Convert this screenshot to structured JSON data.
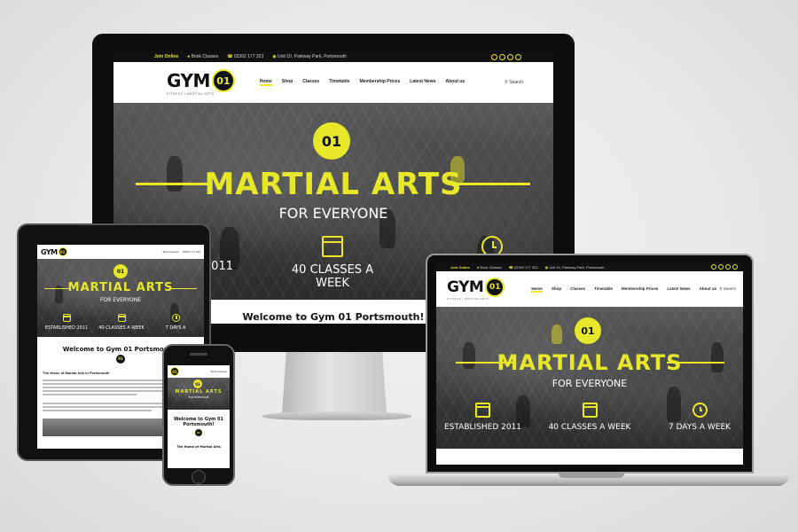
{
  "site": {
    "topbar": {
      "join": "Join Online",
      "book": "Book Classes",
      "phone": "02392 177 323",
      "address": "Unit 10, Parkway Park, Portsmouth"
    },
    "logo": {
      "gym": "GYM",
      "num": "01",
      "sub": "FITNESS | MARTIAL ARTS"
    },
    "menu": [
      "Home",
      "Shop",
      "Classes",
      "Timetable",
      "Membership Prices",
      "Latest News",
      "About us"
    ],
    "search": "Search",
    "hero": {
      "title": "MARTIAL ARTS",
      "subtitle": "FOR EVERYONE",
      "badge": "01",
      "stats": [
        "ESTABLISHED 2011",
        "40 CLASSES A WEEK",
        "7 DAYS A WEEK"
      ]
    },
    "welcome": "Welcome to Gym 01 Portsmouth!",
    "welcome_short_1": "Welcome to Gym 01",
    "welcome_short_2": "Portsmouth!",
    "section": "The Home of Martial Arts in Portsmouth",
    "section_short": "The Home of Martial Arts",
    "imac_partial_stat": "2011",
    "tablet_partial_stat": "7 DAYS A",
    "imac_welcome_cut": "Welcome to Gym 01 Portsmouth!"
  },
  "colors": {
    "accent": "#e8e82a",
    "dark": "#111111",
    "bg": "#e7e7e7"
  },
  "icons": [
    "user-icon",
    "phone-icon",
    "map-pin-icon",
    "instagram-icon",
    "facebook-icon",
    "twitter-icon",
    "youtube-icon",
    "search-icon",
    "calendar-icon",
    "clock-icon"
  ]
}
